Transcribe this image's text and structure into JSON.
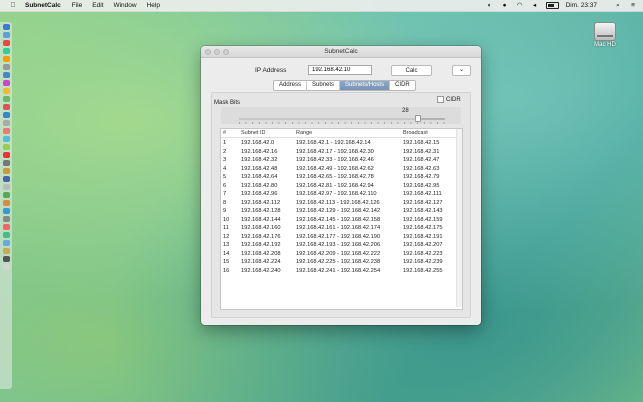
{
  "menubar": {
    "app_name": "SubnetCalc",
    "items": [
      "File",
      "Edit",
      "Window",
      "Help"
    ],
    "clock": "Dim. 23:37"
  },
  "desktop": {
    "drive_label": "Mac HD"
  },
  "window": {
    "title": "SubnetCalc",
    "ip_label": "IP Address",
    "ip_value": "192.168.42.10",
    "calc_label": "Calc",
    "menu_glyph": "⌄",
    "tabs": [
      {
        "label": "Address",
        "selected": false
      },
      {
        "label": "Subnets",
        "selected": false
      },
      {
        "label": "Subnets/Hosts",
        "selected": true
      },
      {
        "label": "CIDR",
        "selected": false
      }
    ],
    "mask_bits_label": "Mask Bits",
    "cidr_checkbox_label": "CIDR",
    "slider_value": "28",
    "slider": {
      "min": 1,
      "max": 32,
      "value": 28
    },
    "table": {
      "headers": [
        "#",
        "Subnet ID",
        "Range",
        "Broadcast"
      ],
      "rows": [
        [
          "1",
          "192.168.42.0",
          "192.168.42.1 - 192.168.42.14",
          "192.168.42.15"
        ],
        [
          "2",
          "192.168.42.16",
          "192.168.42.17 - 192.168.42.30",
          "192.168.42.31"
        ],
        [
          "3",
          "192.168.42.32",
          "192.168.42.33 - 192.168.42.46",
          "192.168.42.47"
        ],
        [
          "4",
          "192.168.42.48",
          "192.168.42.49 - 192.168.42.62",
          "192.168.42.63"
        ],
        [
          "5",
          "192.168.42.64",
          "192.168.42.65 - 192.168.42.78",
          "192.168.42.79"
        ],
        [
          "6",
          "192.168.42.80",
          "192.168.42.81 - 192.168.42.94",
          "192.168.42.95"
        ],
        [
          "7",
          "192.168.42.96",
          "192.168.42.97 - 192.168.42.110",
          "192.168.42.111"
        ],
        [
          "8",
          "192.168.42.112",
          "192.168.42.113 - 192.168.42.126",
          "192.168.42.127"
        ],
        [
          "9",
          "192.168.42.128",
          "192.168.42.129 - 192.168.42.142",
          "192.168.42.143"
        ],
        [
          "10",
          "192.168.42.144",
          "192.168.42.145 - 192.168.42.158",
          "192.168.42.159"
        ],
        [
          "11",
          "192.168.42.160",
          "192.168.42.161 - 192.168.42.174",
          "192.168.42.175"
        ],
        [
          "12",
          "192.168.42.176",
          "192.168.42.177 - 192.168.42.190",
          "192.168.42.191"
        ],
        [
          "13",
          "192.168.42.192",
          "192.168.42.193 - 192.168.42.206",
          "192.168.42.207"
        ],
        [
          "14",
          "192.168.42.208",
          "192.168.42.209 - 192.168.42.222",
          "192.168.42.223"
        ],
        [
          "15",
          "192.168.42.224",
          "192.168.42.225 - 192.168.42.238",
          "192.168.42.239"
        ],
        [
          "16",
          "192.168.42.240",
          "192.168.42.241 - 192.168.42.254",
          "192.168.42.255"
        ]
      ]
    }
  },
  "icons": {
    "apple": "apple-icon",
    "wifi": "wifi-icon",
    "volume": "volume-icon",
    "search": "search-icon",
    "menu_extras": "notification-center-icon",
    "battery": "battery-icon"
  },
  "colors": {
    "tab_selected": "#7f9bbd",
    "window_bg": "#ececec"
  }
}
